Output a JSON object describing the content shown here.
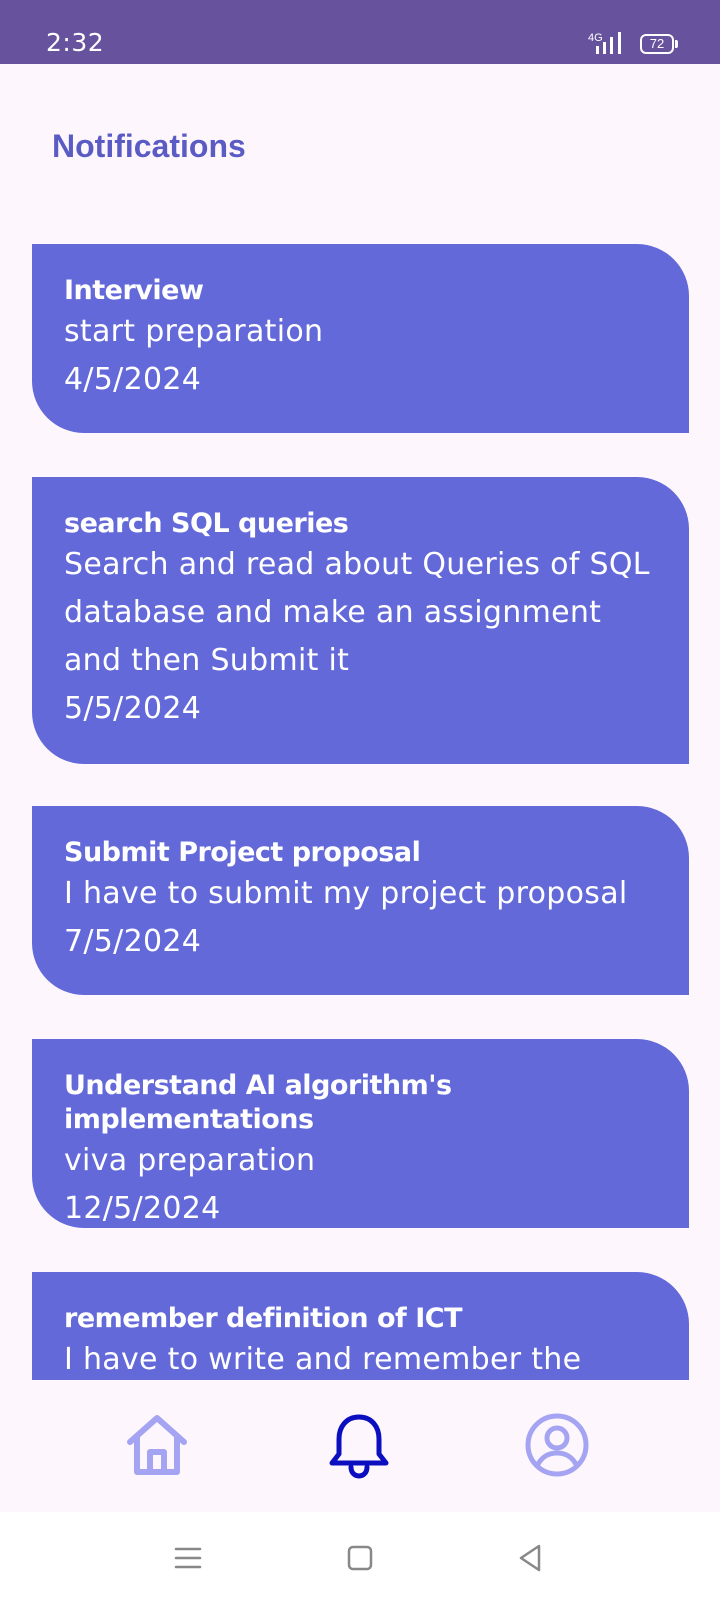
{
  "status_bar": {
    "time": "2:32",
    "network_label": "4G",
    "battery_level": "72",
    "icons": [
      "signal-icon",
      "battery-icon"
    ]
  },
  "header": {
    "title": "Notifications"
  },
  "notifications": [
    {
      "title": "Interview",
      "body": "start preparation",
      "date": "4/5/2024"
    },
    {
      "title": "search SQL queries",
      "body": "Search and read about Queries of SQL database and make an assignment and then Submit it",
      "date": "5/5/2024"
    },
    {
      "title": "Submit Project proposal",
      "body": "I have to submit my project proposal",
      "date": "7/5/2024"
    },
    {
      "title": "Understand AI algorithm's implementations",
      "body": "viva preparation",
      "date": "12/5/2024"
    },
    {
      "title": "remember definition of ICT",
      "body": "I have to write and remember the",
      "date": ""
    }
  ],
  "bottom_nav": {
    "items": [
      {
        "name": "home",
        "icon": "home-icon",
        "active": false
      },
      {
        "name": "notifications",
        "icon": "bell-icon",
        "active": true
      },
      {
        "name": "profile",
        "icon": "account-circle-icon",
        "active": false
      }
    ]
  },
  "system_nav": [
    "menu-icon",
    "square-icon",
    "back-triangle-icon"
  ],
  "colors": {
    "status_bar": "#67529e",
    "title": "#5a5cc4",
    "card": "#6369d9",
    "nav_inactive": "#a4a4f2",
    "nav_active": "#0b0fbf",
    "background": "#fdf7fd"
  }
}
